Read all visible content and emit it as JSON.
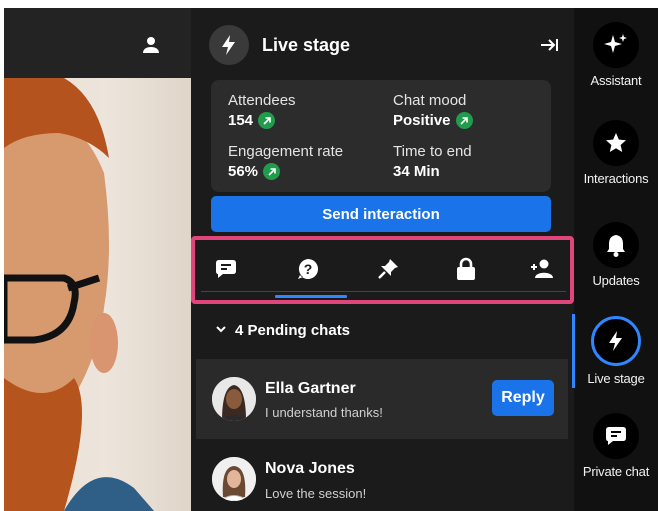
{
  "header": {
    "title": "Live stage"
  },
  "stats": {
    "attendees_label": "Attendees",
    "attendees_value": "154",
    "mood_label": "Chat mood",
    "mood_value": "Positive",
    "engagement_label": "Engagement rate",
    "engagement_value": "56%",
    "time_label": "Time to end",
    "time_value": "34 Min"
  },
  "actions": {
    "send_interaction": "Send interaction"
  },
  "tabs": [
    {
      "icon": "chat-bubble-icon"
    },
    {
      "icon": "question-icon",
      "selected": true
    },
    {
      "icon": "pin-icon"
    },
    {
      "icon": "lock-icon"
    },
    {
      "icon": "users-icon"
    }
  ],
  "pending": {
    "label": "4 Pending chats"
  },
  "chats": [
    {
      "name": "Ella Gartner",
      "message": "I understand thanks!",
      "reply_label": "Reply"
    },
    {
      "name": "Nova Jones",
      "message": "Love the session!"
    }
  ],
  "rail": {
    "items": [
      {
        "label": "Assistant",
        "icon": "sparkle-icon"
      },
      {
        "label": "Interactions",
        "icon": "star-icon"
      },
      {
        "label": "Updates",
        "icon": "bell-icon"
      },
      {
        "label": "Live stage",
        "icon": "lightning-icon",
        "active": true
      },
      {
        "label": "Private chat",
        "icon": "chat-bubble-icon"
      }
    ]
  },
  "colors": {
    "accent_blue": "#1a73e8",
    "highlight_pink": "#e0457b",
    "positive_green": "#1f9d4d"
  }
}
